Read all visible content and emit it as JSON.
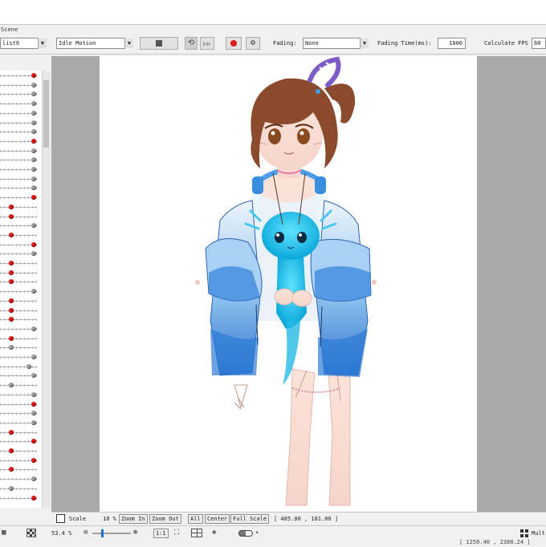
{
  "scene": {
    "tab_label": "Scene"
  },
  "toolbar": {
    "list_value": "list0",
    "motion_value": "Idle Motion",
    "fading_label": "Fading:",
    "fading_value": "None",
    "fading_time_label": "Fading Time(ms):",
    "fading_time_value": "1000",
    "fps_label": "Calculate FPS",
    "fps_value": "60"
  },
  "viewer": {
    "scale_label": "Scale",
    "scale_value": "18 %",
    "zoom_in_label": "Zoom In",
    "zoom_out_label": "Zoom Out",
    "all_label": "All",
    "center_label": "Center",
    "full_scale_label": "Full Scale",
    "coords": "[  485.00 ,  181.00 ]"
  },
  "status": {
    "zoom_value": "53.4 %",
    "ratio_label": "1:1",
    "multi_label": "Mult",
    "partial_readout": "[ 1250.40 , 2380.24 ]"
  },
  "colors": {
    "accent_red": "#e01818",
    "canvas_bg": "#ffffff",
    "viewport_bg": "#a9a9a9"
  }
}
